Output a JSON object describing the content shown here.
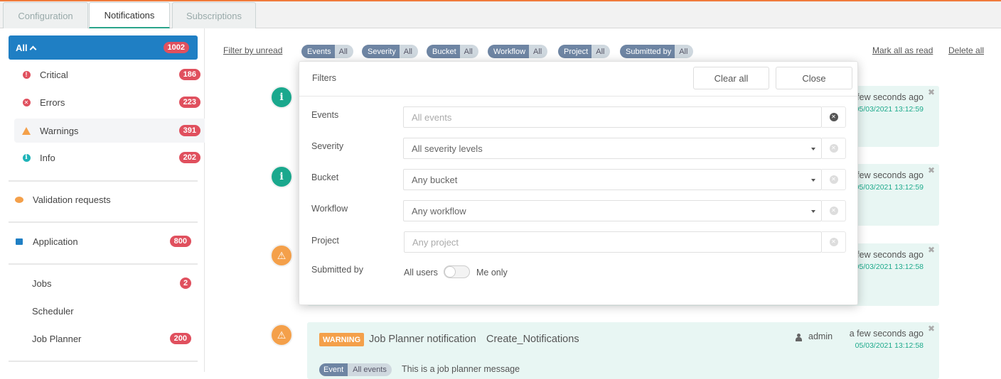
{
  "tabs": [
    {
      "label": "Configuration",
      "active": false
    },
    {
      "label": "Notifications",
      "active": true
    },
    {
      "label": "Subscriptions",
      "active": false
    }
  ],
  "sidebar": {
    "all": {
      "label": "All",
      "count": "1002",
      "icon": "chevron-up-icon"
    },
    "severities": [
      {
        "label": "Critical",
        "count": "186",
        "icon": "exclamation-circle-icon",
        "color": "#e0505e"
      },
      {
        "label": "Errors",
        "count": "223",
        "icon": "x-circle-icon",
        "color": "#e0505e"
      },
      {
        "label": "Warnings",
        "count": "391",
        "icon": "warning-triangle-icon",
        "color": "#f4a04a"
      },
      {
        "label": "Info",
        "count": "202",
        "icon": "info-circle-icon",
        "color": "#1fb3b8"
      }
    ],
    "validation": {
      "label": "Validation requests",
      "icon": "comment-icon",
      "color": "#f4a04a"
    },
    "application": {
      "label": "Application",
      "count": "800",
      "icon": "puzzle-icon",
      "color": "#1f7fc4"
    },
    "apps": [
      {
        "label": "Jobs",
        "count": "2"
      },
      {
        "label": "Scheduler",
        "count": null
      },
      {
        "label": "Job Planner",
        "count": "200"
      }
    ]
  },
  "toolbar": {
    "filter_unread": "Filter by unread",
    "filters": [
      {
        "key": "Events",
        "value": "All"
      },
      {
        "key": "Severity",
        "value": "All"
      },
      {
        "key": "Bucket",
        "value": "All"
      },
      {
        "key": "Workflow",
        "value": "All"
      },
      {
        "key": "Project",
        "value": "All"
      },
      {
        "key": "Submitted by",
        "value": "All"
      }
    ],
    "mark_all_read": "Mark all as read",
    "delete_all": "Delete all"
  },
  "modal": {
    "title": "Filters",
    "clear_all": "Clear all",
    "close": "Close",
    "fields": [
      {
        "label": "Events",
        "placeholder": "All events",
        "type": "multiselect"
      },
      {
        "label": "Severity",
        "value": "All severity levels",
        "type": "select"
      },
      {
        "label": "Bucket",
        "value": "Any bucket",
        "type": "select"
      },
      {
        "label": "Workflow",
        "value": "Any workflow",
        "type": "select"
      },
      {
        "label": "Project",
        "placeholder": "Any project",
        "type": "text"
      }
    ],
    "submitted_by": {
      "label": "Submitted by",
      "left": "All users",
      "right": "Me only",
      "on": false
    }
  },
  "notifications": [
    {
      "severity": "info",
      "time": "a few seconds ago",
      "date": "05/03/2021 13:12:59"
    },
    {
      "severity": "info",
      "time": "a few seconds ago",
      "date": "05/03/2021 13:12:59"
    },
    {
      "severity": "warning",
      "time": "a few seconds ago",
      "date": "05/03/2021 13:12:58"
    },
    {
      "severity": "warning",
      "badge": "WARNING",
      "title": "Job Planner notification",
      "subtitle": "Create_Notifications",
      "user": "admin",
      "time": "a few seconds ago",
      "date": "05/03/2021 13:12:58",
      "tag_key": "Event",
      "tag_value": "All events",
      "message": "This is a job planner message"
    }
  ],
  "colors": {
    "accent": "#1f7fc4",
    "badge": "#e0505e",
    "info": "#1aa88d",
    "warning": "#f4a04a",
    "card_bg": "#e8f6f3",
    "top_line": "#f07b3c"
  }
}
